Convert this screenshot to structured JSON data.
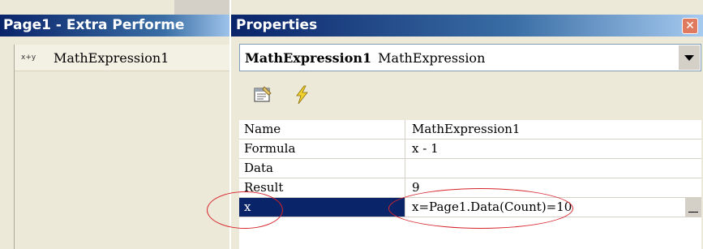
{
  "left_window": {
    "title": "Page1 - Extra Performe",
    "items": [
      {
        "icon": "x+y",
        "label": "MathExpression1"
      }
    ]
  },
  "properties_window": {
    "title": "Properties",
    "close_glyph": "✕",
    "object_selector": {
      "name": "MathExpression1",
      "type": "MathExpression"
    },
    "toolbar": {
      "buttons": [
        {
          "icon": "properties-icon"
        },
        {
          "icon": "events-lightning-icon"
        }
      ]
    },
    "grid": {
      "rows": [
        {
          "name": "Name",
          "value": "MathExpression1"
        },
        {
          "name": "Formula",
          "value": "x - 1"
        },
        {
          "name": "Data",
          "value": ""
        },
        {
          "name": "Result",
          "value": "9"
        },
        {
          "name": "x",
          "value": "x=Page1.Data(Count)=10"
        }
      ],
      "selected_row": "x"
    }
  },
  "colors": {
    "titlebar": "#0a246a",
    "selection": "#0a246a",
    "annotation": "#d6242b",
    "close_button": "#e07a5f"
  }
}
